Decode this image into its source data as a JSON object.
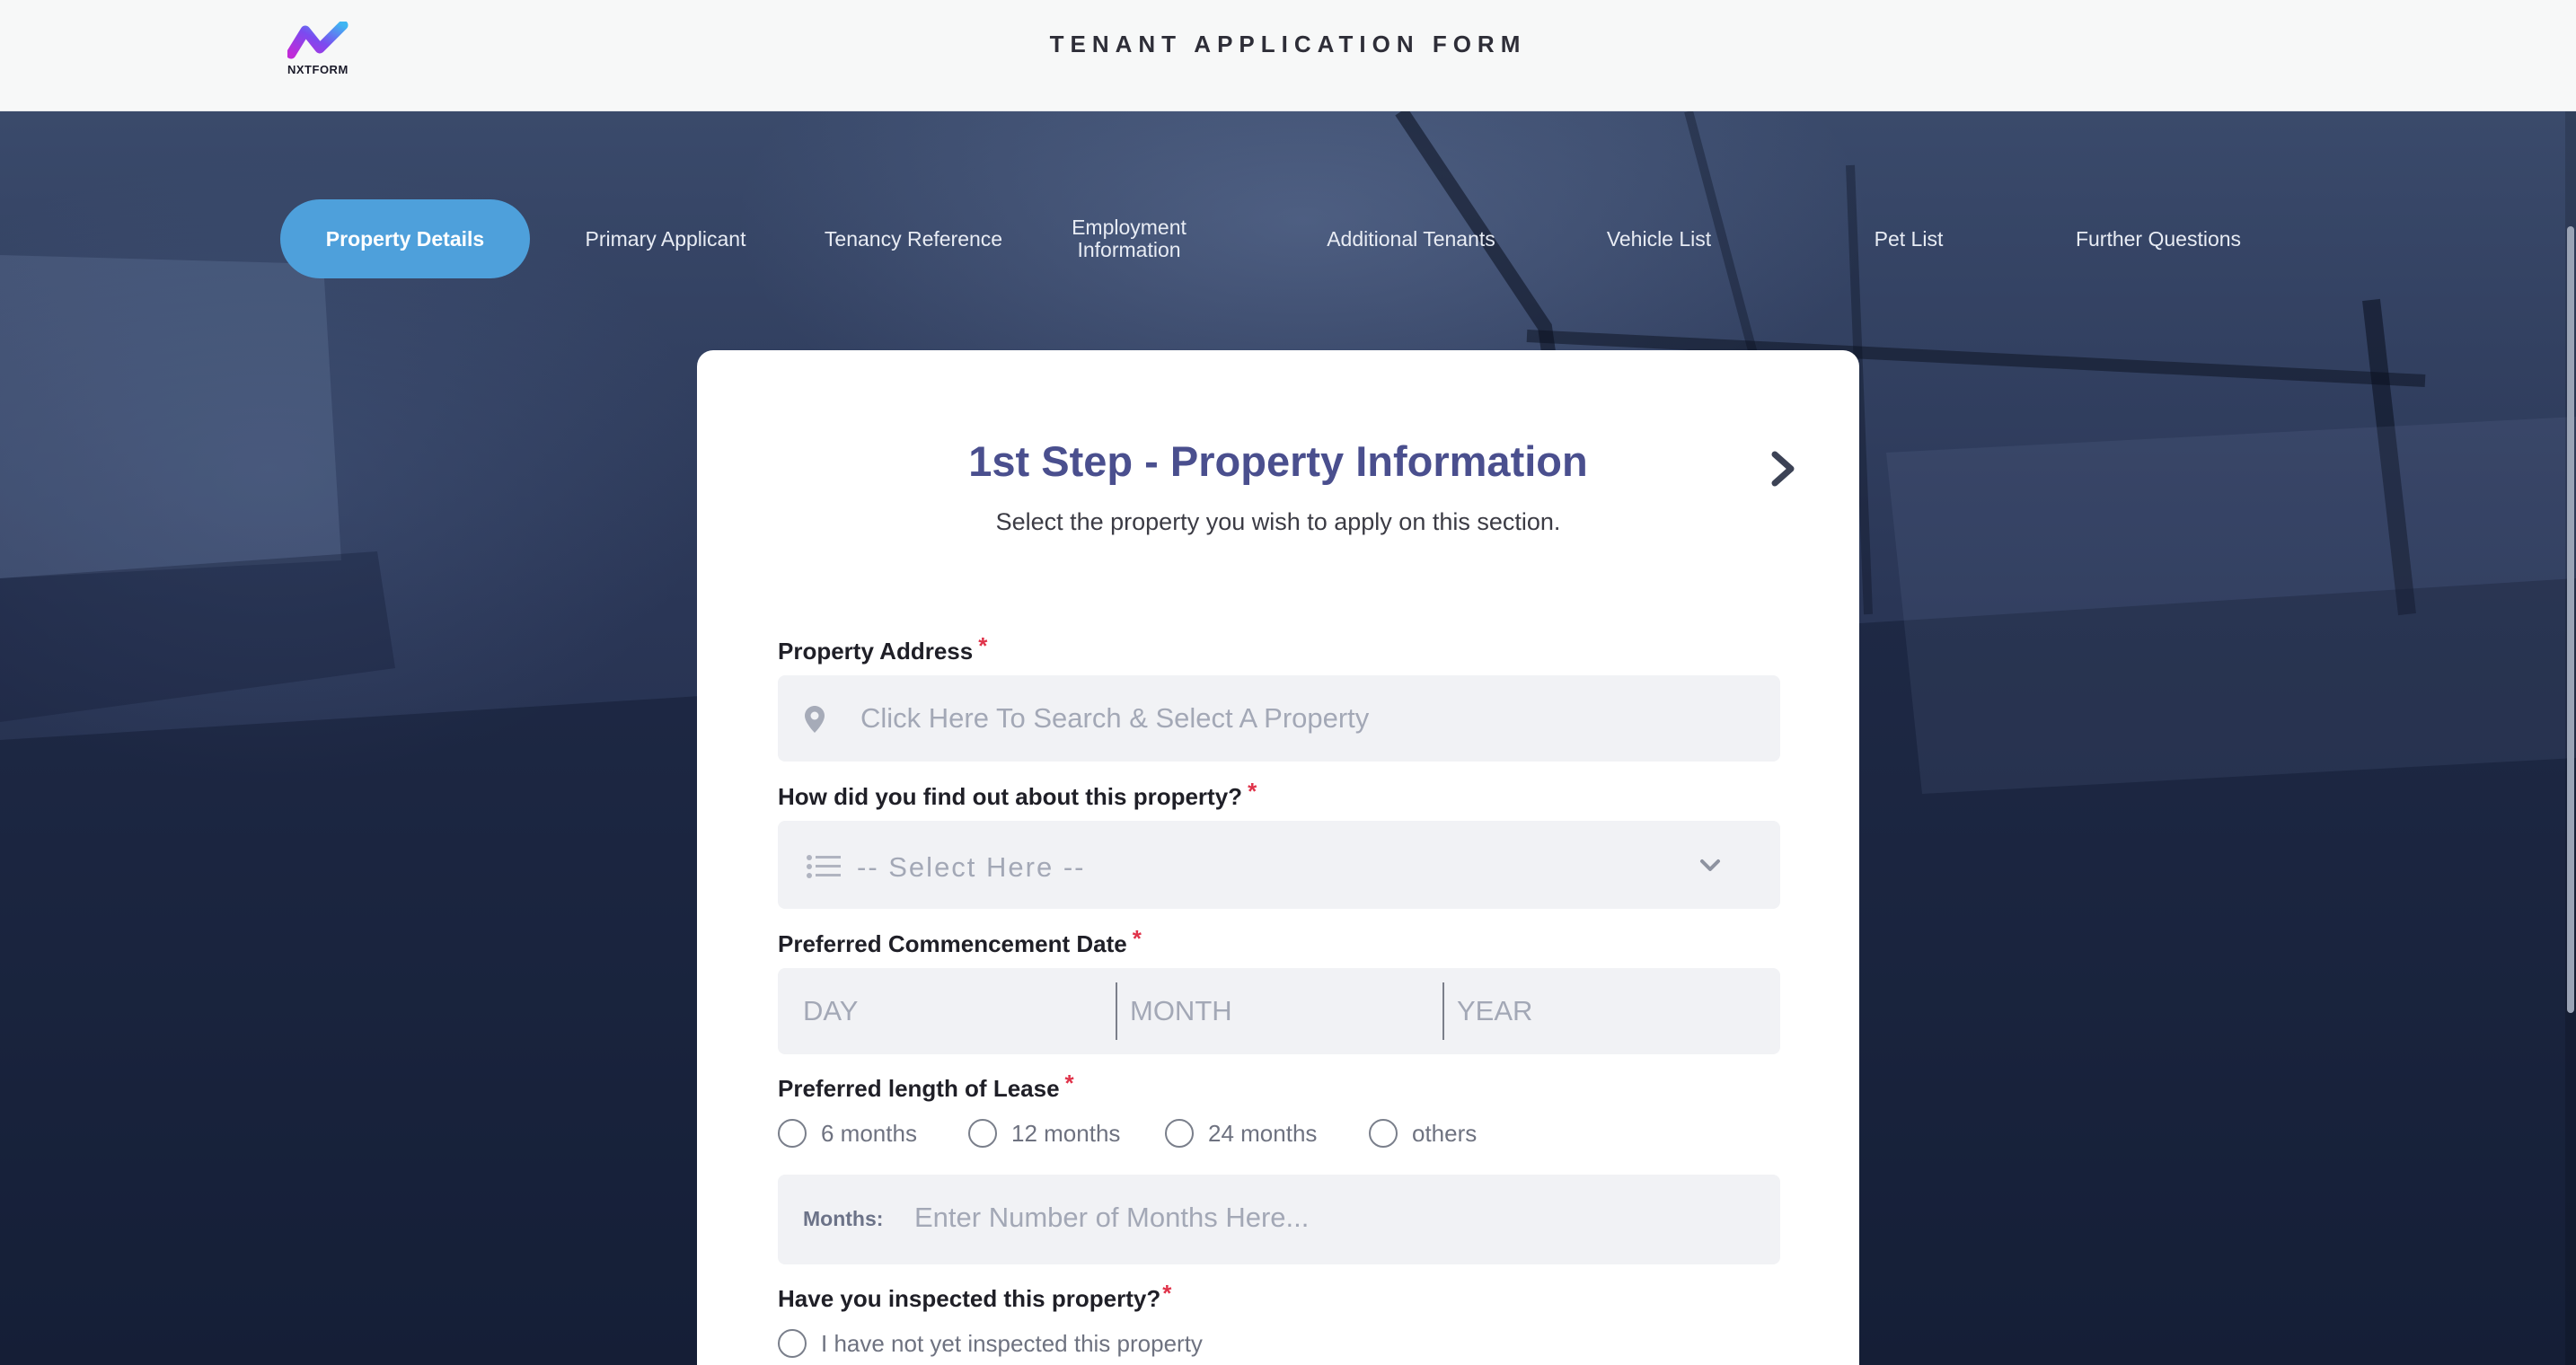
{
  "header": {
    "logo_text": "NXTFORM",
    "title": "TENANT APPLICATION FORM"
  },
  "steps": [
    {
      "label": "Property Details",
      "active": true
    },
    {
      "label": "Primary Applicant"
    },
    {
      "label": "Tenancy Reference"
    },
    {
      "label": "Employment Information"
    },
    {
      "label": "Additional Tenants"
    },
    {
      "label": "Vehicle List"
    },
    {
      "label": "Pet List"
    },
    {
      "label": "Further Questions"
    }
  ],
  "card": {
    "title": "1st Step - Property Information",
    "subtitle": "Select the property you wish to apply on this section."
  },
  "form": {
    "property_address": {
      "label": "Property Address",
      "required": "*",
      "placeholder": "Click Here To Search & Select A Property"
    },
    "find_out": {
      "label": "How did you find out about this property?",
      "required": "*",
      "selected": "-- Select Here --"
    },
    "commencement_date": {
      "label": "Preferred Commencement Date",
      "required": "*",
      "day_placeholder": "DAY",
      "month_placeholder": "MONTH",
      "year_placeholder": "YEAR"
    },
    "lease_length": {
      "label": "Preferred length of Lease",
      "required": "*",
      "options": [
        "6 months",
        "12 months",
        "24 months",
        "others"
      ],
      "months_label": "Months:",
      "months_placeholder": "Enter Number of Months Here..."
    },
    "inspected": {
      "label": "Have you inspected this property?",
      "required": "*",
      "options": [
        "I have not yet inspected this property"
      ]
    }
  },
  "colors": {
    "accent": "#4ea0db",
    "title": "#4a4f8e",
    "required": "#e0334a",
    "field_bg": "#f1f2f5"
  }
}
